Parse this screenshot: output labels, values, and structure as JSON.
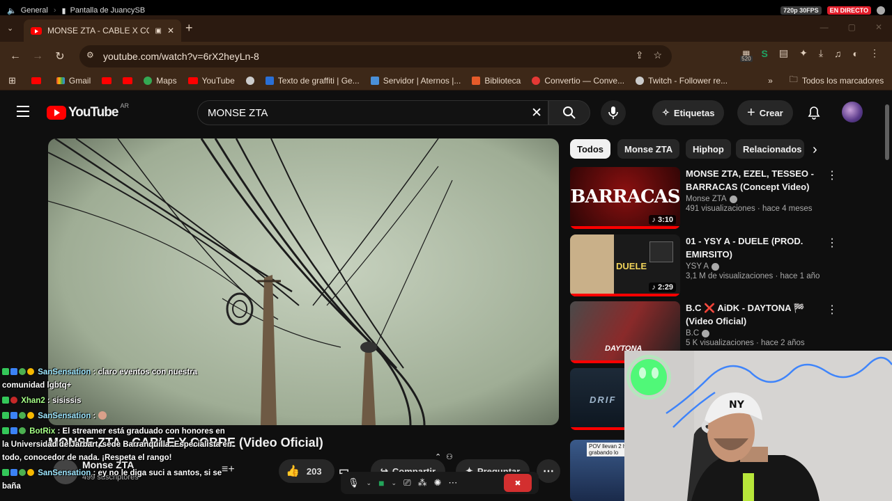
{
  "topstrip": {
    "channel": "General",
    "screen_share": "Pantalla de JuancySB",
    "quality": "720p 30FPS",
    "live": "EN DIRECTO"
  },
  "browser": {
    "tab_title": "MONSE ZTA - CABLE X COB",
    "url": "youtube.com/watch?v=6rX2heyLn-8",
    "ext_count": "520",
    "bookmarks": [
      {
        "label": "",
        "icon": "youtube-icon"
      },
      {
        "label": "Gmail",
        "icon": "gmail-icon"
      },
      {
        "label": "",
        "icon": "youtube-icon"
      },
      {
        "label": "",
        "icon": "youtube-icon"
      },
      {
        "label": "Maps",
        "icon": "maps-icon"
      },
      {
        "label": "YouTube",
        "icon": "youtube-icon"
      },
      {
        "label": "",
        "icon": "globe-icon"
      },
      {
        "label": "Texto de graffiti | Ge...",
        "icon": "text-icon"
      },
      {
        "label": "Servidor | Aternos |...",
        "icon": "aternos-icon"
      },
      {
        "label": "Biblioteca",
        "icon": "library-icon"
      },
      {
        "label": "Convertio — Conve...",
        "icon": "convertio-icon"
      },
      {
        "label": "Twitch - Follower re...",
        "icon": "globe-icon"
      }
    ],
    "all_bookmarks": "Todos los marcadores"
  },
  "youtube": {
    "logo": "YouTube",
    "country": "AR",
    "search_value": "MONSE ZTA",
    "btn_tags": "Etiquetas",
    "btn_create": "Crear"
  },
  "video": {
    "title": "MONSE ZTA - CABLE X COBRE (Video Oficial)",
    "channel": "Monse ZTA",
    "subs": "499 suscriptores",
    "likes": "203",
    "share": "Compartir",
    "ask": "Preguntar"
  },
  "chips": [
    "Todos",
    "Monse ZTA",
    "Hiphop",
    "Relacionados"
  ],
  "recommended": [
    {
      "title": "MONSE ZTA, EZEL, TESSEO - BARRACAS (Concept Video)",
      "channel": "Monse ZTA",
      "meta": "491 visualizaciones · hace 4 meses",
      "duration": "3:10",
      "thumb_text": "BARRACAS"
    },
    {
      "title": "01 - YSY A - DUELE (PROD. EMIRSITO)",
      "channel": "YSY A",
      "meta": "3,1 M de visualizaciones · hace 1 año",
      "duration": "2:29",
      "thumb_text": "DUELE"
    },
    {
      "title": "B.C ❌ AiDK - DAYTONA 🏁 (Video Oficial)",
      "channel": "B.C",
      "meta": "5 K visualizaciones · hace 2 años",
      "duration": "",
      "thumb_text": "DAYTONA"
    },
    {
      "title": "",
      "channel": "",
      "meta": "",
      "duration": "",
      "thumb_text": "DRIF"
    },
    {
      "title": "",
      "channel": "",
      "meta": "",
      "duration": "",
      "thumb_text": "POV llevan 2 h grabando lo"
    }
  ],
  "chat": [
    {
      "user": "SanSensation",
      "text": ": claro eventos con nuestra comunidad lgbtq+",
      "color": "#9ee7ff"
    },
    {
      "user": "Xhan2",
      "text": ": sisissis",
      "color": "#a6ff87"
    },
    {
      "user": "SanSensation",
      "text": ":",
      "color": "#9ee7ff"
    },
    {
      "user": "BotRix",
      "text": ": El streamer está graduado con honores en la Universidad de Jarbart, sede Barranquilla. Especialista en todo, conocedor de nada. ¡Respeta el rango!",
      "color": "#a6ff87"
    },
    {
      "user": "SanSensation",
      "text": ": ey no le diga suci a santos, si se baña",
      "color": "#9ee7ff"
    }
  ]
}
